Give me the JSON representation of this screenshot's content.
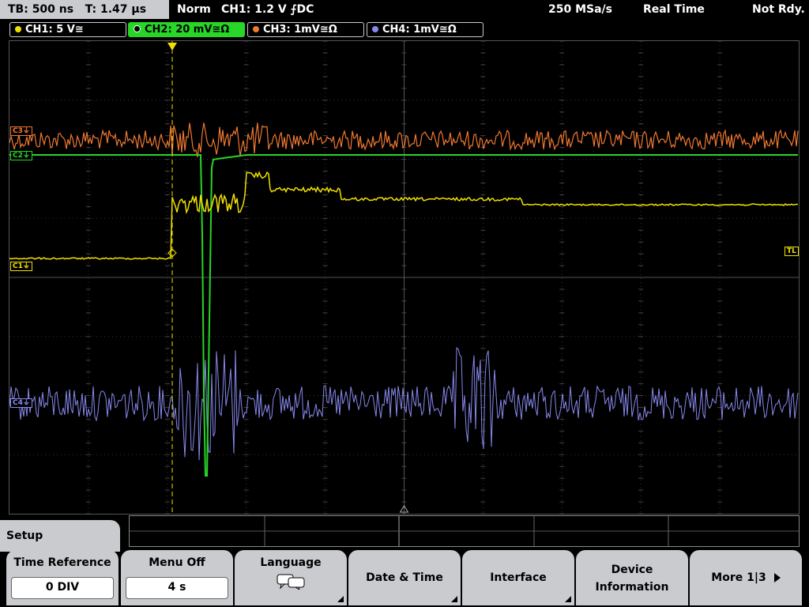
{
  "status": {
    "timebase": "TB: 500 ns",
    "trigger_time": "T: 1.47 µs",
    "mode": "Norm",
    "trigger_setting": "CH1: 1.2 V ⨍DC",
    "sample_rate": "250 MSa/s",
    "acq_mode": "Real Time",
    "state": "Not Rdy."
  },
  "channels": [
    {
      "label": "CH1: 5 V≅",
      "color": "#f0e000"
    },
    {
      "label": "CH2: 20 mV≅Ω",
      "color": "#27d627"
    },
    {
      "label": "CH3: 1mV≅Ω",
      "color": "#f07830"
    },
    {
      "label": "CH4: 1mV≅Ω",
      "color": "#8888ee"
    }
  ],
  "markers": {
    "c1": "C1⏚",
    "c2": "C2⏚",
    "c3": "C3⏚",
    "c4": "C4⏚",
    "tl": "TL"
  },
  "menu": {
    "title": "Setup",
    "keys": [
      {
        "label": "Time Reference",
        "value": "0 DIV"
      },
      {
        "label": "Menu Off",
        "value": "4 s"
      },
      {
        "label": "Language",
        "icon": "speech-bubbles-icon"
      },
      {
        "label": "Date & Time"
      },
      {
        "label": "Interface"
      },
      {
        "label": "Device",
        "label2": "Information"
      },
      {
        "label": "More 1|3"
      }
    ]
  }
}
